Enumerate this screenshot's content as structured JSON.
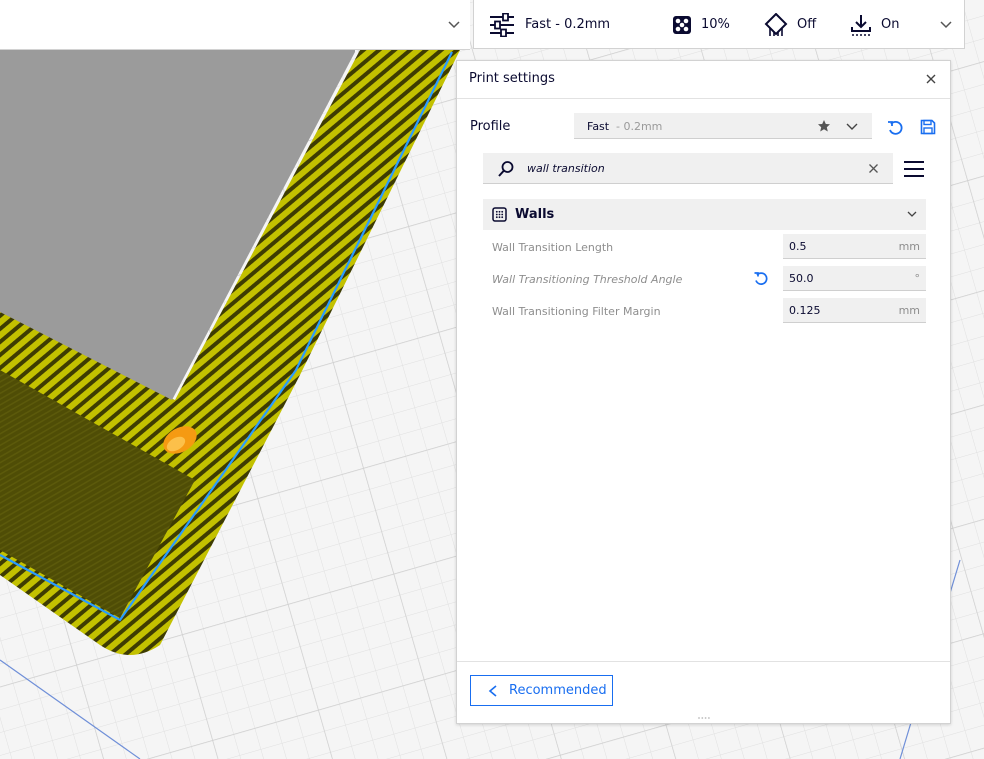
{
  "stage_menu": {
    "profile": "Fast - 0.2mm",
    "infill": "10%",
    "support": "Off",
    "adhesion": "On"
  },
  "print_settings": {
    "title": "Print settings",
    "profile_label": "Profile",
    "profile_name": "Fast",
    "profile_suffix": " - 0.2mm",
    "search_value": "wall transition",
    "category": {
      "label": "Walls",
      "icon": "walls-grid-icon"
    },
    "settings": [
      {
        "label": "Wall Transition Length",
        "value": "0.5",
        "unit": "mm",
        "modified": false
      },
      {
        "label": "Wall Transitioning Threshold Angle",
        "value": "50.0",
        "unit": "°",
        "modified": true
      },
      {
        "label": "Wall Transitioning Filter Margin",
        "value": "0.125",
        "unit": "mm",
        "modified": false
      }
    ],
    "recommended_label": "Recommended"
  },
  "colors": {
    "accent": "#196ef0",
    "text": "#0a0a30",
    "muted": "#8e8e8e",
    "field": "#f0f0f0",
    "toolpath_yellow": "#c4c200",
    "top_surface": "#9a9a9a",
    "wall_shade": "#4e4c05",
    "outline_blue": "#2a9bff",
    "seam_orange": "#f59a12"
  }
}
